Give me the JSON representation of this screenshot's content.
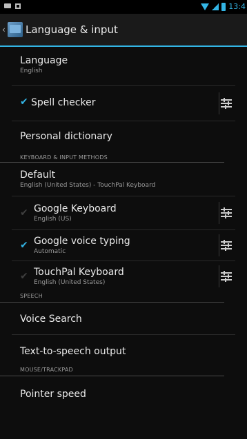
{
  "status": {
    "time": "13:4"
  },
  "app_bar": {
    "title": "Language & input"
  },
  "items": {
    "language": {
      "title": "Language",
      "summary": "English"
    },
    "spell_checker": {
      "title": "Spell checker",
      "checked": true
    },
    "personal_dictionary": {
      "title": "Personal dictionary"
    },
    "keyboard_header": "KEYBOARD & INPUT METHODS",
    "default": {
      "title": "Default",
      "summary": "English (United States) - TouchPal Keyboard"
    },
    "google_keyboard": {
      "title": "Google Keyboard",
      "summary": "English (US)",
      "checked": false
    },
    "google_voice": {
      "title": "Google voice typing",
      "summary": "Automatic",
      "checked": true
    },
    "touchpal": {
      "title": "TouchPal Keyboard",
      "summary": "English (United States)",
      "checked": false
    },
    "speech_header": "SPEECH",
    "voice_search": {
      "title": "Voice Search"
    },
    "tts": {
      "title": "Text-to-speech output"
    },
    "mouse_header": "MOUSE/TRACKPAD",
    "pointer_speed": {
      "title": "Pointer speed"
    }
  },
  "colors": {
    "accent": "#33b5e5",
    "background": "#0d0d0d"
  },
  "icons": [
    "wifi-icon",
    "signal-icon",
    "battery-icon",
    "back-icon",
    "app-icon",
    "settings-icon",
    "checkbox-icon"
  ]
}
